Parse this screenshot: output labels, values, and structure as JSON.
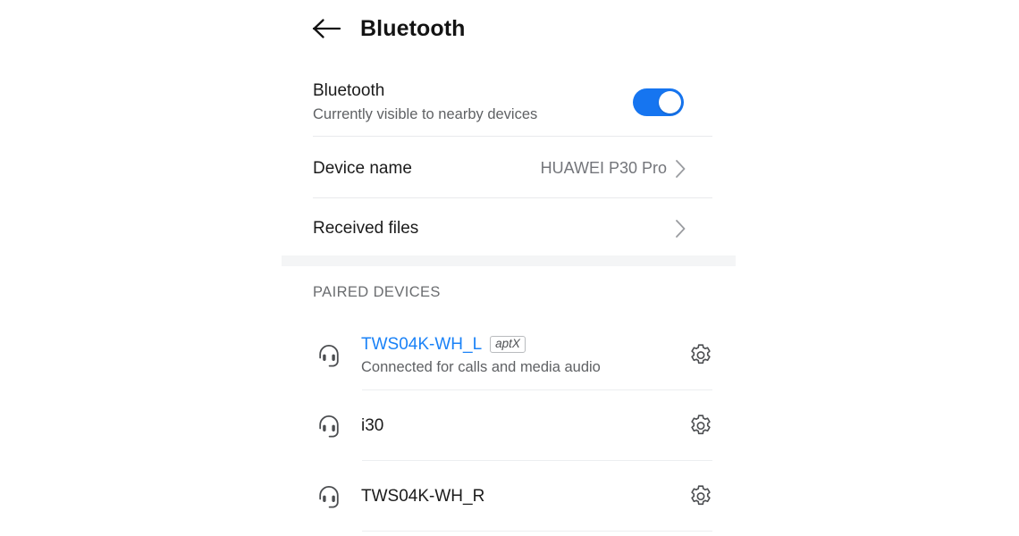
{
  "header": {
    "back_icon": "back-arrow-icon",
    "title": "Bluetooth"
  },
  "bluetooth_toggle": {
    "title": "Bluetooth",
    "subtitle": "Currently visible to nearby devices",
    "state": "on",
    "accent_color": "#1675f0"
  },
  "rows": [
    {
      "label": "Device name",
      "value": "HUAWEI P30 Pro",
      "chevron_icon": "chevron-right-icon"
    },
    {
      "label": "Received files",
      "value": "",
      "chevron_icon": "chevron-right-icon"
    }
  ],
  "paired_section": {
    "caption": "PAIRED DEVICES",
    "devices": [
      {
        "name": "TWS04K-WH_L",
        "codec_badge": "aptX",
        "status": "Connected for calls and media audio",
        "connected": true,
        "name_color": "#1a82f7",
        "device_icon": "headphones-icon",
        "settings_icon": "gear-icon"
      },
      {
        "name": "i30",
        "codec_badge": "",
        "status": "",
        "connected": false,
        "name_color": "#1b1b1b",
        "device_icon": "headphones-icon",
        "settings_icon": "gear-icon"
      },
      {
        "name": "TWS04K-WH_R",
        "codec_badge": "",
        "status": "",
        "connected": false,
        "name_color": "#1b1b1b",
        "device_icon": "headphones-icon",
        "settings_icon": "gear-icon"
      }
    ]
  }
}
